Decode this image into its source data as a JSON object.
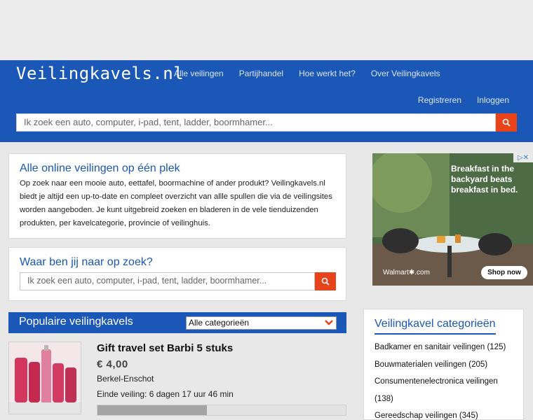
{
  "header": {
    "logo": "Veilingkavels.nl",
    "nav": [
      "Alle veilingen",
      "Partijhandel",
      "Hoe werkt het?",
      "Over Veilingkavels"
    ],
    "register": "Registreren",
    "login": "Inloggen",
    "search_placeholder": "Ik zoek een auto, computer, i-pad, tent, ladder, boormhamer..."
  },
  "intro": {
    "title": "Alle online veilingen op één plek",
    "text": "Op zoek naar een mooie auto, eettafel, boormachine of ander produkt? Veilingkavels.nl biedt je altijd een up-to-date en compleet overzicht van allle spullen die via de veilingsites worden aangeboden. Je kunt uitgebreid zoeken en bladeren in de vele tienduizenden produkten, per kavelcategorie, provincie of veilinghuis."
  },
  "find": {
    "title": "Waar ben jij naar op zoek?",
    "search_placeholder": "Ik zoek een auto, computer, i-pad, tent, ladder, boormhamer..."
  },
  "popular": {
    "title": "Populaire veilingkavels",
    "category_selected": "Alle categorieën"
  },
  "product": {
    "title": "Gift travel set Barbi 5 stuks",
    "price": "€ 4,00",
    "location": "Berkel-Enschot",
    "end": "Einde veiling: 6 dagen 17 uur 46 min",
    "progress": 0.44
  },
  "ad": {
    "text": "Breakfast in the backyard beats breakfast in bed.",
    "button": "Shop now",
    "brand": "Walmart",
    "brand_suffix": ".com"
  },
  "categories": {
    "title": "Veilingkavel categorieën",
    "items": [
      "Badkamer en sanitair veilingen (125)",
      "Bouwmaterialen veilingen (205)",
      "Consumentenelectronica veilingen",
      "(138)",
      "Gereedschap veilingen (345)"
    ]
  },
  "colors": {
    "brand_blue": "#1a57b7",
    "accent_orange": "#e8431a"
  }
}
